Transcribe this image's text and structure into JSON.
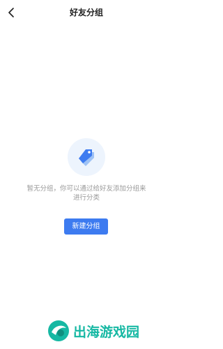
{
  "header": {
    "title": "好友分组"
  },
  "empty_state": {
    "illustration_icon": "price-tag-icon",
    "message": "暂无分组，你可以通过给好友添加分组来进行分类"
  },
  "actions": {
    "create_group_label": "新建分组"
  },
  "watermark": {
    "text": "出海游戏园"
  },
  "colors": {
    "primary": "#3d7bf0",
    "illustration_bg": "#edf4fd",
    "muted_text": "#9a9a9a",
    "watermark": "#16b8a3"
  }
}
